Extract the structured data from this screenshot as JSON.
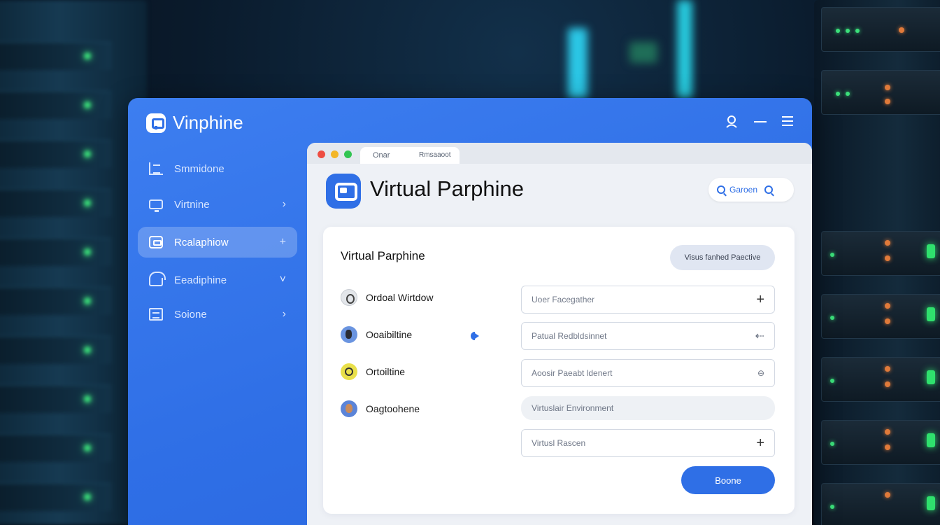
{
  "app": {
    "title": "Vinphine"
  },
  "sidebar": {
    "items": [
      {
        "label": "Smmidone",
        "icon": "list-icon",
        "chevron": ""
      },
      {
        "label": "Virtnine",
        "icon": "monitor-icon",
        "chevron": "›"
      },
      {
        "label": "Rcalaphiow",
        "icon": "chat-icon",
        "chevron": "+",
        "active": true
      },
      {
        "label": "Eeadiphine",
        "icon": "home-icon",
        "chevron": "˅"
      },
      {
        "label": "Soione",
        "icon": "document-icon",
        "chevron": "›"
      }
    ]
  },
  "browser": {
    "tab_labels": [
      "Onar",
      "Rmsaaoot"
    ],
    "header_title": "Virtual Parphine",
    "search_label": "Garoen"
  },
  "card": {
    "title": "Virtual Parphine",
    "action_button": "Visus fanhed Paective",
    "rows": [
      {
        "label": "Ordoal Wirtdow",
        "avatar": "avatar-gray"
      },
      {
        "label": "Ooaibiltine",
        "avatar": "avatar-blue"
      },
      {
        "label": "Ortoiltine",
        "avatar": "avatar-yellow"
      },
      {
        "label": "Oagtoohene",
        "avatar": "avatar-blue-2"
      }
    ],
    "fields": [
      {
        "value": "Uoer Facegather",
        "suffix": "+"
      },
      {
        "value": "Patual Redbldsinnet",
        "suffix": "⇠"
      },
      {
        "value": "Aoosir Paeabt ldenert",
        "suffix": "⊖"
      },
      {
        "value": "Virtuslair Environment",
        "suffix": ""
      },
      {
        "value": "Virtusl Rascen",
        "suffix": "+"
      }
    ],
    "primary_button": "Boone"
  },
  "colors": {
    "brand_blue": "#2f6fe6",
    "window_bg": "#eef1f6",
    "card_bg": "#ffffff"
  }
}
